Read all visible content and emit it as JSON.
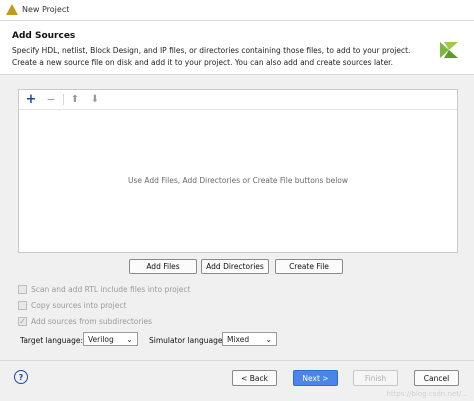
{
  "window": {
    "title": "New Project"
  },
  "header": {
    "title": "Add Sources",
    "description": "Specify HDL, netlist, Block Design, and IP files, or directories containing those files, to add to your project. Create a new source file on disk and add it to your project. You can also add and create sources later."
  },
  "toolbar": {
    "add_icon": "plus-icon",
    "remove_icon": "minus-icon",
    "up_icon": "arrow-up-icon",
    "down_icon": "arrow-down-icon"
  },
  "list": {
    "empty_message": "Use Add Files, Add Directories or Create File buttons below"
  },
  "actions": {
    "add_files": "Add Files",
    "add_directories": "Add Directories",
    "create_file": "Create File"
  },
  "options": {
    "scan_rtl": {
      "label": "Scan and add RTL include files into project",
      "checked": false
    },
    "copy_sources": {
      "label": "Copy sources into project",
      "checked": false
    },
    "add_subdirs": {
      "label": "Add sources from subdirectories",
      "checked": true
    }
  },
  "target_language": {
    "label": "Target language:",
    "value": "Verilog"
  },
  "simulator_language": {
    "label": "Simulator language:",
    "value": "Mixed"
  },
  "footer": {
    "help": "?",
    "back": "< Back",
    "next": "Next >",
    "finish": "Finish",
    "cancel": "Cancel"
  },
  "watermark": "https://blog.csdn.net/..."
}
